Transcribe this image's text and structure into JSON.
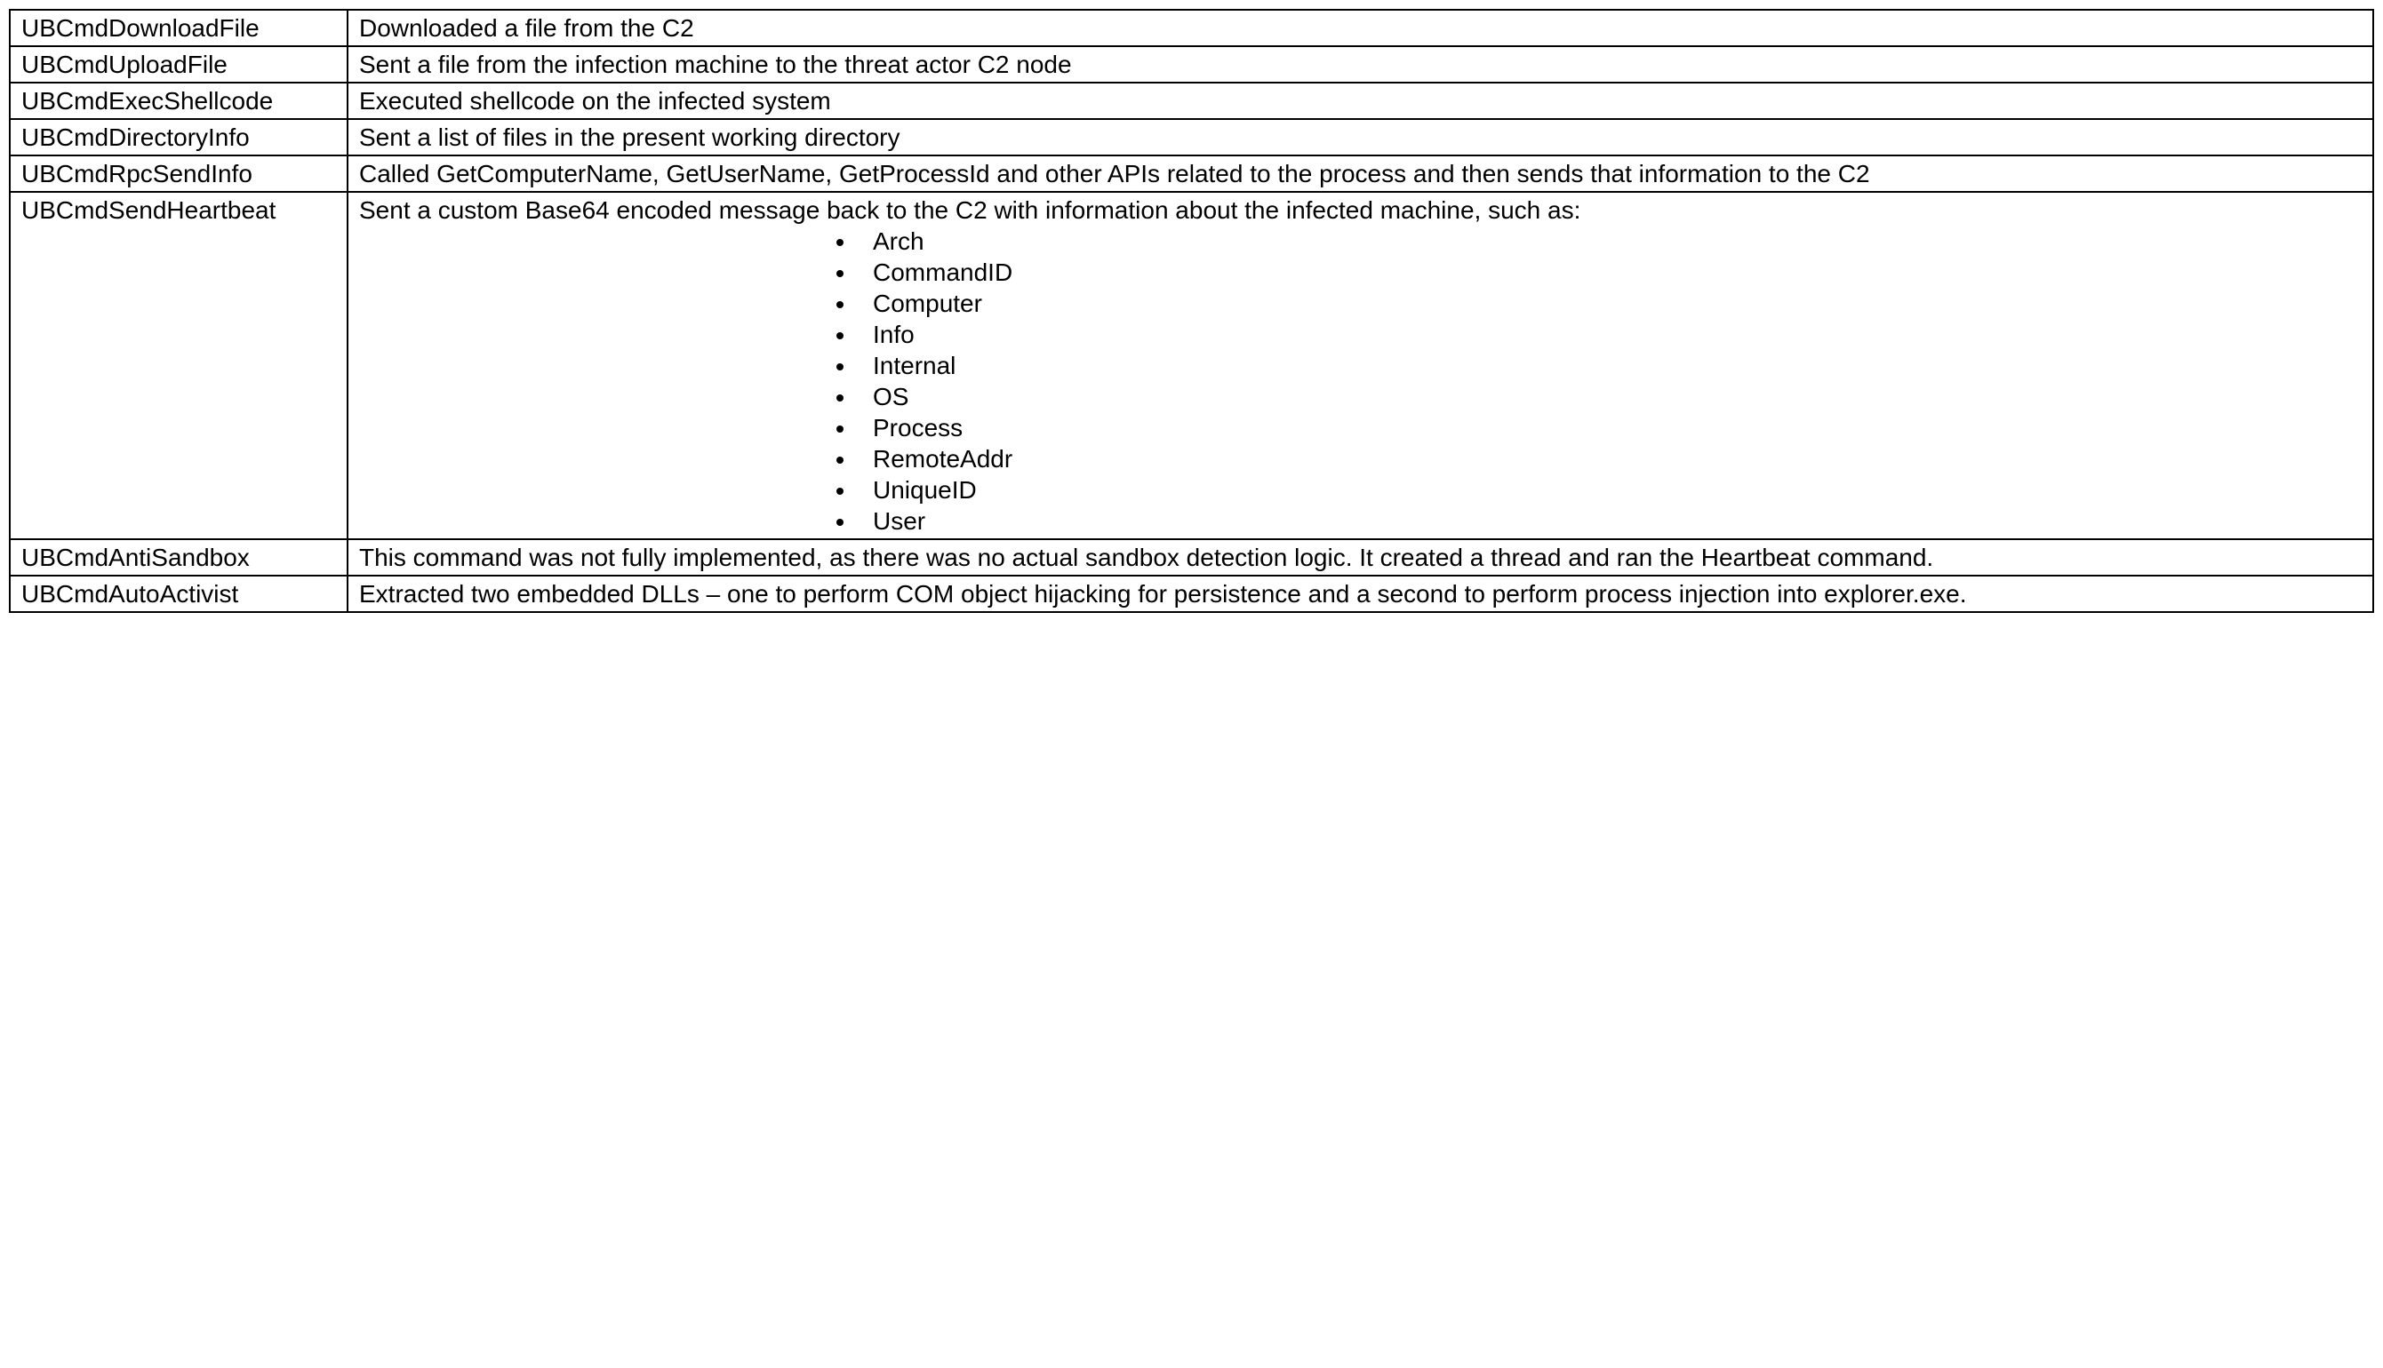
{
  "rows": [
    {
      "name": "UBCmdDownloadFile",
      "desc": "Downloaded a file from the C2"
    },
    {
      "name": "UBCmdUploadFile",
      "desc": "Sent a file from the infection machine to the threat actor C2 node"
    },
    {
      "name": "UBCmdExecShellcode",
      "desc": "Executed shellcode on the infected system"
    },
    {
      "name": "UBCmdDirectoryInfo",
      "desc": "Sent a list of files in the present working directory"
    },
    {
      "name": "UBCmdRpcSendInfo",
      "desc": "Called GetComputerName, GetUserName, GetProcessId and other APIs related to the process and then sends that information to the C2"
    },
    {
      "name": "UBCmdSendHeartbeat",
      "desc": "Sent a custom Base64 encoded message back to the C2 with information about the infected machine, such as:",
      "bullets": [
        "Arch",
        "CommandID",
        "Computer",
        "Info",
        "Internal",
        "OS",
        "Process",
        "RemoteAddr",
        "UniqueID",
        "User"
      ]
    },
    {
      "name": "UBCmdAntiSandbox",
      "desc": "This command was not fully implemented, as there was no actual sandbox detection logic. It created a thread and ran the Heartbeat command."
    },
    {
      "name": "UBCmdAutoActivist",
      "desc": "Extracted two embedded DLLs – one to perform COM object hijacking for persistence and a second to perform process injection into explorer.exe."
    }
  ]
}
